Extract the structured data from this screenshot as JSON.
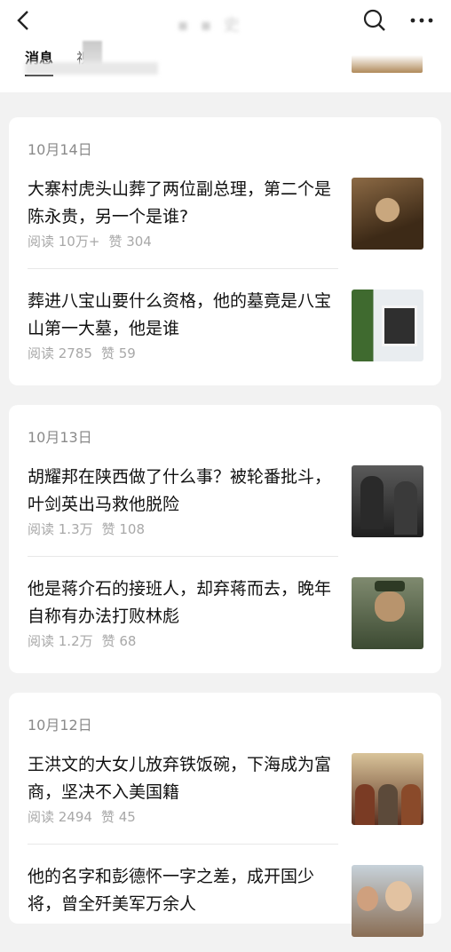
{
  "header": {
    "tabs": [
      "消息",
      "视"
    ]
  },
  "sections": [
    {
      "date": "10月14日",
      "articles": [
        {
          "title": "大寨村虎头山葬了两位副总理，第二个是陈永贵，另一个是谁?",
          "reads": "阅读 10万+",
          "likes": "赞 304"
        },
        {
          "title": "葬进八宝山要什么资格，他的墓竟是八宝山第一大墓，他是谁",
          "reads": "阅读 2785",
          "likes": "赞 59"
        }
      ]
    },
    {
      "date": "10月13日",
      "articles": [
        {
          "title": "胡耀邦在陕西做了什么事？被轮番批斗，叶剑英出马救他脱险",
          "reads": "阅读 1.3万",
          "likes": "赞 108"
        },
        {
          "title": "他是蒋介石的接班人，却弃蒋而去，晚年自称有办法打败林彪",
          "reads": "阅读 1.2万",
          "likes": "赞 68"
        }
      ]
    },
    {
      "date": "10月12日",
      "articles": [
        {
          "title": "王洪文的大女儿放弃铁饭碗，下海成为富商，坚决不入美国籍",
          "reads": "阅读 2494",
          "likes": "赞 45"
        },
        {
          "title": "他的名字和彭德怀一字之差，成开国少将，曾全歼美军万余人",
          "reads": "",
          "likes": ""
        }
      ]
    }
  ]
}
